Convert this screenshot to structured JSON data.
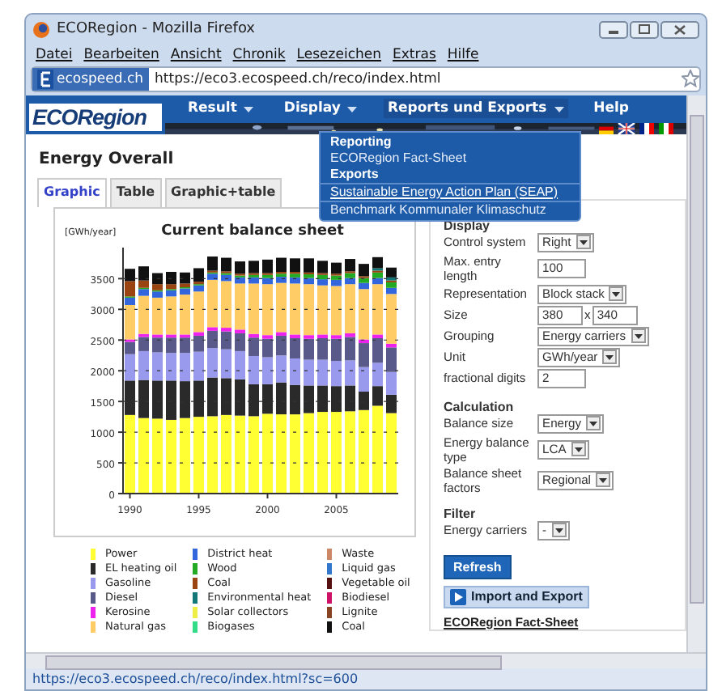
{
  "window": {
    "title": "ECORegion - Mozilla Firefox"
  },
  "menu_bar": [
    "Datei",
    "Bearbeiten",
    "Ansicht",
    "Chronik",
    "Lesezeichen",
    "Extras",
    "Hilfe"
  ],
  "address_bar": {
    "site": "ecospeed.ch",
    "url": "https://eco3.ecospeed.ch/reco/index.html"
  },
  "header": {
    "logo": "ECORegion",
    "nav": [
      {
        "label": "Result",
        "has_menu": true,
        "expanded": false
      },
      {
        "label": "Display",
        "has_menu": true,
        "expanded": false
      },
      {
        "label": "Reports und Exports",
        "has_menu": true,
        "expanded": true
      },
      {
        "label": "Help",
        "has_menu": false,
        "expanded": false
      }
    ]
  },
  "dropdown": [
    {
      "kind": "heading",
      "label": "Reporting"
    },
    {
      "kind": "item",
      "label": "ECORegion Fact-Sheet",
      "selected": false
    },
    {
      "kind": "heading",
      "label": "Exports"
    },
    {
      "kind": "item",
      "label": "Sustainable Energy Action Plan (SEAP)",
      "selected": true
    },
    {
      "kind": "item",
      "label": "Benchmark Kommunaler Klimaschutz",
      "selected": false
    }
  ],
  "page_title": "Energy Overall",
  "tabs": [
    {
      "label": "Graphic",
      "selected": true
    },
    {
      "label": "Table",
      "selected": false
    },
    {
      "label": "Graphic+table",
      "selected": false
    }
  ],
  "chart": {
    "chart_data": {
      "type": "bar",
      "stacked": true,
      "title": "Current balance sheet",
      "ylabel": "[GWh/year]",
      "x": [
        1990,
        1991,
        1992,
        1993,
        1994,
        1995,
        1996,
        1997,
        1998,
        1999,
        2000,
        2001,
        2002,
        2003,
        2004,
        2005,
        2006,
        2007,
        2008,
        2009
      ],
      "xticks": [
        1990,
        1995,
        2000,
        2005
      ],
      "xlim": [
        1989.5,
        2009.5
      ],
      "grid": true,
      "yticks": [
        0,
        500,
        1000,
        1500,
        2000,
        2500,
        3000,
        3500
      ],
      "ylim": [
        0,
        3900
      ],
      "series": [
        {
          "name": "Power",
          "color": "#ffff33",
          "values": [
            1280,
            1230,
            1220,
            1200,
            1230,
            1250,
            1260,
            1280,
            1270,
            1260,
            1300,
            1290,
            1290,
            1310,
            1330,
            1330,
            1340,
            1360,
            1430,
            1310
          ]
        },
        {
          "name": "EL heating oil",
          "color": "#2a2a2a",
          "values": [
            560,
            620,
            620,
            640,
            600,
            590,
            630,
            600,
            590,
            520,
            480,
            520,
            480,
            450,
            430,
            420,
            420,
            300,
            320,
            300
          ]
        },
        {
          "name": "Gasoline",
          "color": "#9999ee",
          "values": [
            430,
            470,
            460,
            450,
            460,
            470,
            480,
            470,
            460,
            460,
            440,
            440,
            430,
            420,
            420,
            410,
            410,
            400,
            380,
            370
          ]
        },
        {
          "name": "Diesel",
          "color": "#5a5a8a",
          "values": [
            200,
            230,
            240,
            250,
            250,
            260,
            280,
            290,
            290,
            300,
            300,
            320,
            330,
            340,
            350,
            360,
            380,
            390,
            400,
            400
          ]
        },
        {
          "name": "Kerosine",
          "color": "#ee22ee",
          "values": [
            40,
            50,
            50,
            50,
            50,
            60,
            60,
            60,
            60,
            60,
            60,
            60,
            60,
            60,
            60,
            60,
            60,
            60,
            60,
            60
          ]
        },
        {
          "name": "Natural gas",
          "color": "#ffcc66",
          "values": [
            560,
            620,
            600,
            620,
            650,
            660,
            770,
            760,
            750,
            820,
            830,
            800,
            830,
            830,
            800,
            800,
            800,
            820,
            820,
            810
          ]
        },
        {
          "name": "District heat",
          "color": "#3366dd",
          "values": [
            120,
            110,
            100,
            100,
            100,
            100,
            100,
            100,
            100,
            100,
            100,
            100,
            100,
            100,
            100,
            100,
            100,
            100,
            100,
            100
          ]
        },
        {
          "name": "Wood",
          "color": "#22aa22",
          "values": [
            20,
            20,
            20,
            20,
            20,
            20,
            20,
            30,
            30,
            40,
            50,
            50,
            60,
            60,
            70,
            70,
            80,
            80,
            90,
            90
          ]
        },
        {
          "name": "Coal",
          "color": "#994411",
          "values": [
            250,
            120,
            100,
            80,
            60,
            40,
            30,
            30,
            30,
            30,
            30,
            30,
            30,
            30,
            30,
            30,
            30,
            30,
            30,
            30
          ]
        },
        {
          "name": "Environmental heat",
          "color": "#117777",
          "values": [
            0,
            0,
            0,
            0,
            0,
            0,
            0,
            0,
            0,
            0,
            0,
            0,
            0,
            0,
            0,
            0,
            0,
            0,
            40,
            50
          ]
        },
        {
          "name": "Solar collectors",
          "color": "#eeee44",
          "values": [
            0,
            0,
            0,
            0,
            0,
            0,
            0,
            0,
            0,
            0,
            0,
            0,
            0,
            0,
            0,
            0,
            0,
            0,
            0,
            0
          ]
        },
        {
          "name": "Biogases",
          "color": "#33dd88",
          "values": [
            0,
            0,
            0,
            0,
            0,
            0,
            0,
            0,
            0,
            0,
            0,
            0,
            0,
            0,
            0,
            0,
            0,
            0,
            0,
            0
          ]
        },
        {
          "name": "Waste",
          "color": "#cc8866",
          "values": [
            0,
            0,
            0,
            0,
            0,
            0,
            0,
            0,
            0,
            0,
            0,
            0,
            0,
            0,
            0,
            0,
            0,
            0,
            0,
            0
          ]
        },
        {
          "name": "Liquid gas",
          "color": "#3377cc",
          "values": [
            0,
            0,
            0,
            0,
            0,
            0,
            0,
            0,
            0,
            0,
            0,
            0,
            0,
            0,
            0,
            0,
            0,
            0,
            0,
            0
          ]
        },
        {
          "name": "Vegetable oil",
          "color": "#551111",
          "values": [
            0,
            0,
            0,
            0,
            0,
            0,
            0,
            0,
            0,
            0,
            0,
            0,
            0,
            0,
            0,
            0,
            0,
            0,
            0,
            0
          ]
        },
        {
          "name": "Biodiesel",
          "color": "#cc1166",
          "values": [
            0,
            0,
            0,
            0,
            0,
            0,
            0,
            0,
            0,
            0,
            0,
            0,
            0,
            0,
            0,
            0,
            0,
            0,
            0,
            0
          ]
        },
        {
          "name": "Lignite",
          "color": "#884422",
          "values": [
            0,
            0,
            0,
            0,
            0,
            0,
            0,
            0,
            0,
            0,
            0,
            0,
            0,
            0,
            0,
            0,
            0,
            0,
            0,
            0
          ]
        },
        {
          "name": "Coal",
          "color": "#111111",
          "values": [
            200,
            230,
            180,
            200,
            180,
            220,
            230,
            220,
            200,
            200,
            220,
            230,
            220,
            230,
            200,
            180,
            200,
            200,
            180,
            160
          ]
        }
      ]
    }
  },
  "settings": [
    {
      "title": "Display",
      "rows": [
        {
          "label": "Control system",
          "kind": "select",
          "value": "Right"
        },
        {
          "label": "Max. entry length",
          "kind": "input",
          "value": "100"
        },
        {
          "label": "Representation",
          "kind": "select",
          "value": "Block stack"
        },
        {
          "label": "Size",
          "kind": "size",
          "value": "380",
          "separator": "x",
          "value_2": "340"
        },
        {
          "label": "Grouping",
          "kind": "select",
          "value": "Energy carriers"
        },
        {
          "label": "Unit",
          "kind": "select",
          "value": "GWh/year"
        },
        {
          "label": "fractional digits",
          "kind": "input",
          "value": "2"
        }
      ]
    },
    {
      "title": "Calculation",
      "rows": [
        {
          "label": "Balance size",
          "kind": "select",
          "value": "Energy"
        },
        {
          "label": "Energy balance type",
          "kind": "select",
          "value": "LCA"
        },
        {
          "label": "Balance sheet factors",
          "kind": "select",
          "value": "Regional"
        }
      ]
    },
    {
      "title": "Filter",
      "rows": [
        {
          "label": "Energy carriers",
          "kind": "select",
          "value": "-"
        }
      ]
    }
  ],
  "refresh_button": "Refresh",
  "import_export_link": "Import and Export",
  "fact_sheet_link": "ECORegion Fact-Sheet",
  "status_bar": "https://eco3.ecospeed.ch/reco/index.html?sc=600"
}
